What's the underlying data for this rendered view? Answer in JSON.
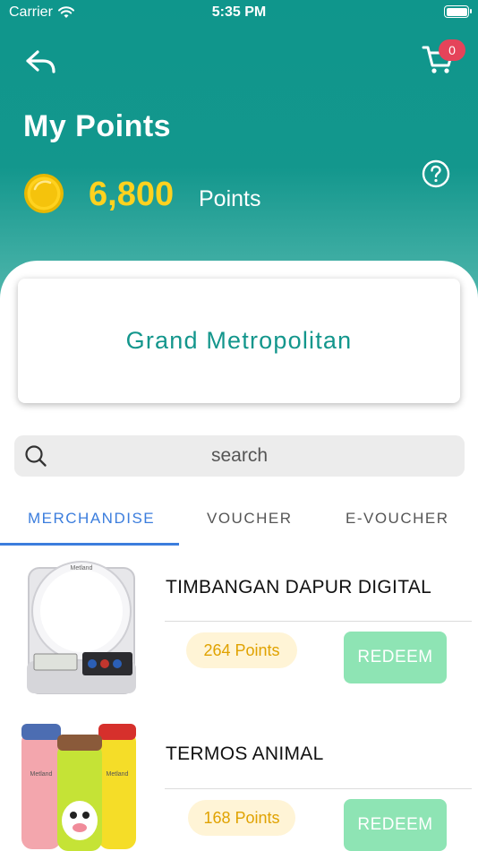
{
  "status_bar": {
    "carrier": "Carrier",
    "time": "5:35 PM"
  },
  "header": {
    "title": "My Points",
    "points_value": "6,800",
    "points_label": "Points",
    "cart_count": "0"
  },
  "store": {
    "name": "Grand Metropolitan"
  },
  "search": {
    "placeholder": "search"
  },
  "tabs": [
    {
      "label": "MERCHANDISE",
      "active": true
    },
    {
      "label": "VOUCHER",
      "active": false
    },
    {
      "label": "E-VOUCHER",
      "active": false
    }
  ],
  "products": [
    {
      "name": "TIMBANGAN DAPUR DIGITAL",
      "points": "264 Points",
      "redeem_label": "REDEEM"
    },
    {
      "name": "TERMOS ANIMAL",
      "points": "168 Points",
      "redeem_label": "REDEEM"
    }
  ],
  "colors": {
    "header_teal": "#13978d",
    "points_yellow": "#ffd21f",
    "tab_active": "#3b7ddd",
    "redeem_green": "#8ee4b4",
    "badge_red": "#e5435a"
  }
}
